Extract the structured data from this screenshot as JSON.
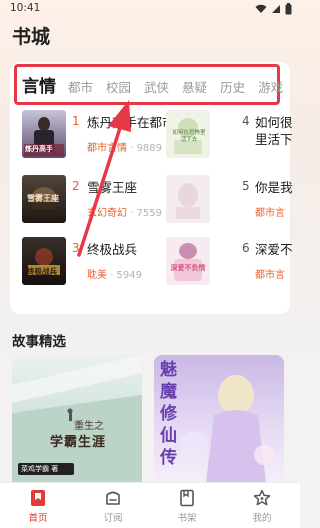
{
  "status_bar": {
    "time": "10:41"
  },
  "page_title": "书城",
  "tabs": [
    {
      "label": "言情",
      "active": true
    },
    {
      "label": "都市"
    },
    {
      "label": "校园"
    },
    {
      "label": "武侠"
    },
    {
      "label": "悬疑"
    },
    {
      "label": "历史"
    },
    {
      "label": "游戏"
    }
  ],
  "ranking": {
    "left": [
      {
        "rank": "1",
        "title": "炼丹高手在都市",
        "genre": "都市言情",
        "count": "9889"
      },
      {
        "rank": "2",
        "title": "雪雾王座",
        "genre": "玄幻奇幻",
        "count": "7559"
      },
      {
        "rank": "3",
        "title": "终极战兵",
        "genre": "耽美",
        "count": "5949"
      }
    ],
    "right": [
      {
        "rank": "4",
        "title": "如何很",
        "title2": "里活下",
        "genre": ""
      },
      {
        "rank": "5",
        "title": "你是我",
        "genre": "都市言"
      },
      {
        "rank": "6",
        "title": "深爱不",
        "genre": "都市言"
      }
    ],
    "covers": {
      "c1": "炼丹高手",
      "c2": "雪雾王座",
      "c3": "终极战兵",
      "c4": "如何在恐怖里活下去",
      "c6": "深爱不负情"
    }
  },
  "section_title": "故事精选",
  "story_cards": [
    {
      "title_top": "重生之",
      "title_main": "学霸生涯",
      "caption": "菜鸡学霸 著"
    },
    {
      "title_main": "魅魔修仙传"
    }
  ],
  "bottom_nav": [
    {
      "label": "首页",
      "active": true
    },
    {
      "label": "订阅"
    },
    {
      "label": "书架"
    },
    {
      "label": "我的"
    }
  ],
  "colors": {
    "accent": "#e23a35",
    "orange": "#e8622c",
    "highlight": "#e73847"
  }
}
